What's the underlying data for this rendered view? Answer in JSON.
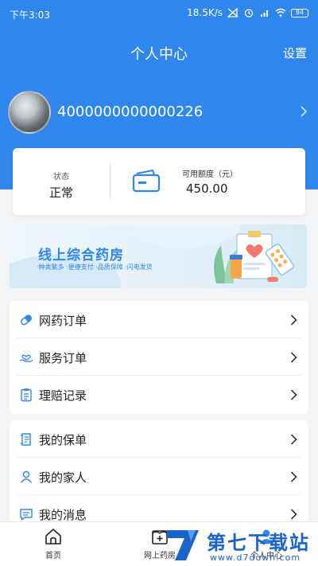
{
  "status_bar": {
    "time": "下午3:03",
    "network_speed": "18.5K/s",
    "battery": "84",
    "icons": [
      "signal-off-icon",
      "alarm-icon",
      "hd-signal-icon",
      "wifi-icon",
      "battery-icon"
    ]
  },
  "header": {
    "title": "个人中心",
    "settings_label": "设置"
  },
  "profile": {
    "user_id": "4000000000000226"
  },
  "account_card": {
    "status_label": "状态",
    "status_value": "正常",
    "credit_label": "可用额度（元）",
    "credit_value": "450.00"
  },
  "banner": {
    "title": "线上综合药房",
    "subtitle": "·种类繁多 ·便捷支付 ·品质保障 ·闪电发货"
  },
  "menu_group_1": [
    {
      "label": "网药订单",
      "icon": "pill-icon"
    },
    {
      "label": "服务订单",
      "icon": "heart-hand-icon"
    },
    {
      "label": "理赔记录",
      "icon": "clipboard-icon"
    }
  ],
  "menu_group_2": [
    {
      "label": "我的保单",
      "icon": "policy-icon"
    },
    {
      "label": "我的家人",
      "icon": "person-icon"
    },
    {
      "label": "我的消息",
      "icon": "message-icon"
    }
  ],
  "tab_bar": {
    "home": "首页",
    "pharmacy": "网上药房",
    "me": "个人中心"
  },
  "watermark": {
    "text": "第七下载站",
    "url": "www.d7down.com"
  },
  "colors": {
    "brand_blue": "#2f86ec",
    "background": "#f3f4f6"
  }
}
